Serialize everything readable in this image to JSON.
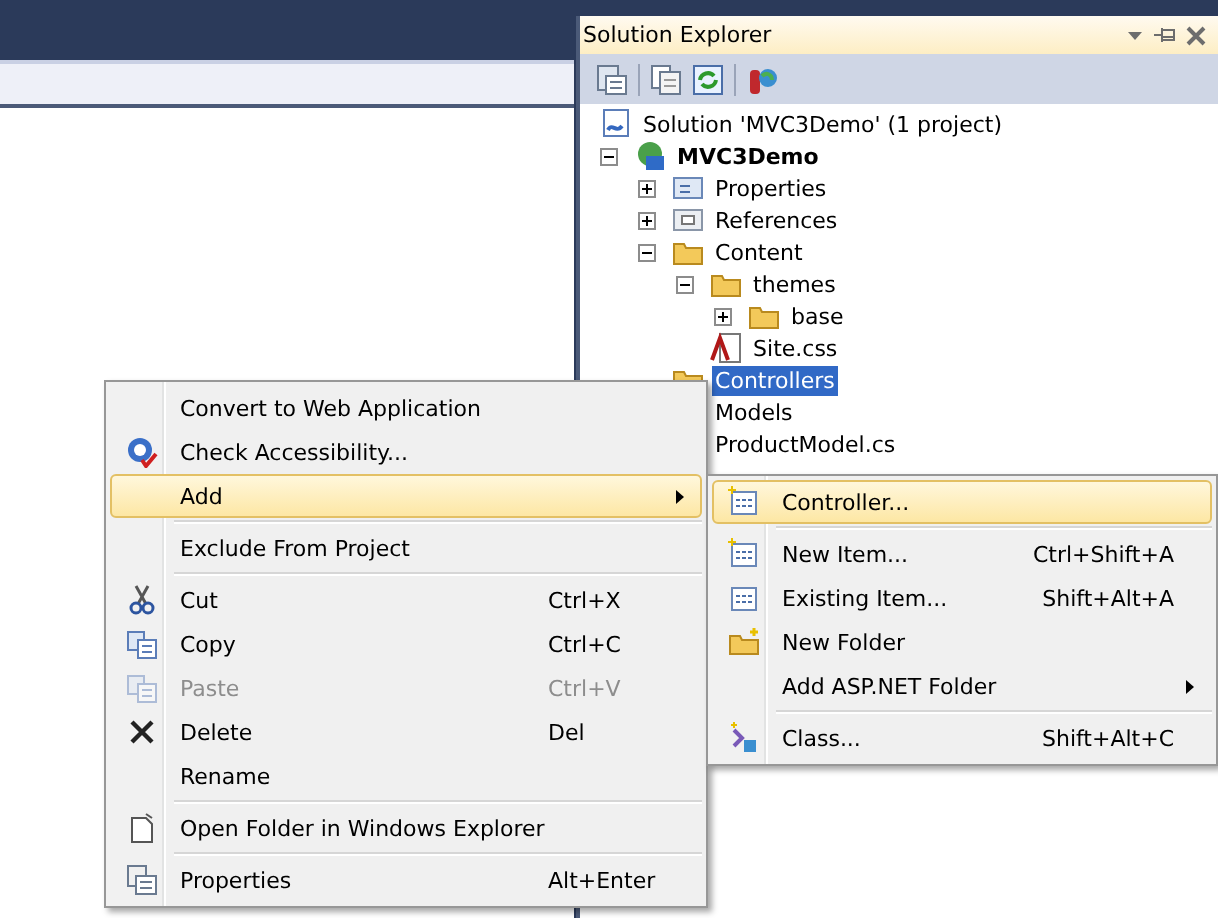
{
  "solution_explorer": {
    "title": "Solution Explorer",
    "tree": [
      {
        "label": "Solution 'MVC3Demo' (1 project)",
        "kind": "solution",
        "selected": false
      },
      {
        "label": "MVC3Demo",
        "kind": "project",
        "bold": true,
        "expanded": true,
        "selected": false,
        "children": [
          {
            "label": "Properties",
            "kind": "properties",
            "expanded": false,
            "selected": false
          },
          {
            "label": "References",
            "kind": "references",
            "expanded": false,
            "selected": false
          },
          {
            "label": "Content",
            "kind": "folder",
            "expanded": true,
            "selected": false,
            "children": [
              {
                "label": "themes",
                "kind": "folder",
                "expanded": true,
                "selected": false,
                "children": [
                  {
                    "label": "base",
                    "kind": "folder",
                    "expanded": false,
                    "selected": false
                  }
                ]
              },
              {
                "label": "Site.css",
                "kind": "css",
                "selected": false
              }
            ]
          },
          {
            "label": "Controllers",
            "kind": "folder",
            "selected": true
          },
          {
            "label": "Models",
            "kind": "folder",
            "selected": false
          },
          {
            "label": "ProductModel.cs",
            "kind": "cs",
            "selected": false
          }
        ]
      }
    ]
  },
  "context_menu": {
    "items": [
      {
        "label": "Convert to Web Application",
        "selected": false,
        "disabled": false
      },
      {
        "label": "Check Accessibility...",
        "kind": "accessibility",
        "selected": false,
        "disabled": false
      },
      {
        "label": "Add",
        "selected": true,
        "disabled": false,
        "submenu": true,
        "separator_after": true
      },
      {
        "label": "Exclude From Project",
        "selected": false,
        "disabled": false,
        "separator_after": true
      },
      {
        "label": "Cut",
        "shortcut": "Ctrl+X",
        "kind": "cut",
        "selected": false,
        "disabled": false
      },
      {
        "label": "Copy",
        "shortcut": "Ctrl+C",
        "kind": "copy",
        "selected": false,
        "disabled": false
      },
      {
        "label": "Paste",
        "shortcut": "Ctrl+V",
        "kind": "paste",
        "selected": false,
        "disabled": true
      },
      {
        "label": "Delete",
        "shortcut": "Del",
        "kind": "delete",
        "selected": false,
        "disabled": false
      },
      {
        "label": "Rename",
        "selected": false,
        "disabled": false,
        "separator_after": true
      },
      {
        "label": "Open Folder in Windows Explorer",
        "kind": "open-folder",
        "selected": false,
        "disabled": false,
        "separator_after": true
      },
      {
        "label": "Properties",
        "shortcut": "Alt+Enter",
        "kind": "properties",
        "selected": false,
        "disabled": false
      }
    ]
  },
  "add_submenu": {
    "items": [
      {
        "label": "Controller...",
        "kind": "controller",
        "selected": true,
        "disabled": false,
        "separator_after": true
      },
      {
        "label": "New Item...",
        "shortcut": "Ctrl+Shift+A",
        "kind": "new-item",
        "selected": false,
        "disabled": false
      },
      {
        "label": "Existing Item...",
        "shortcut": "Shift+Alt+A",
        "kind": "existing-item",
        "selected": false,
        "disabled": false
      },
      {
        "label": "New Folder",
        "kind": "new-folder",
        "selected": false,
        "disabled": false
      },
      {
        "label": "Add ASP.NET Folder",
        "selected": false,
        "disabled": false,
        "submenu": true,
        "separator_after": true
      },
      {
        "label": "Class...",
        "shortcut": "Shift+Alt+C",
        "kind": "class",
        "selected": false,
        "disabled": false
      }
    ]
  }
}
